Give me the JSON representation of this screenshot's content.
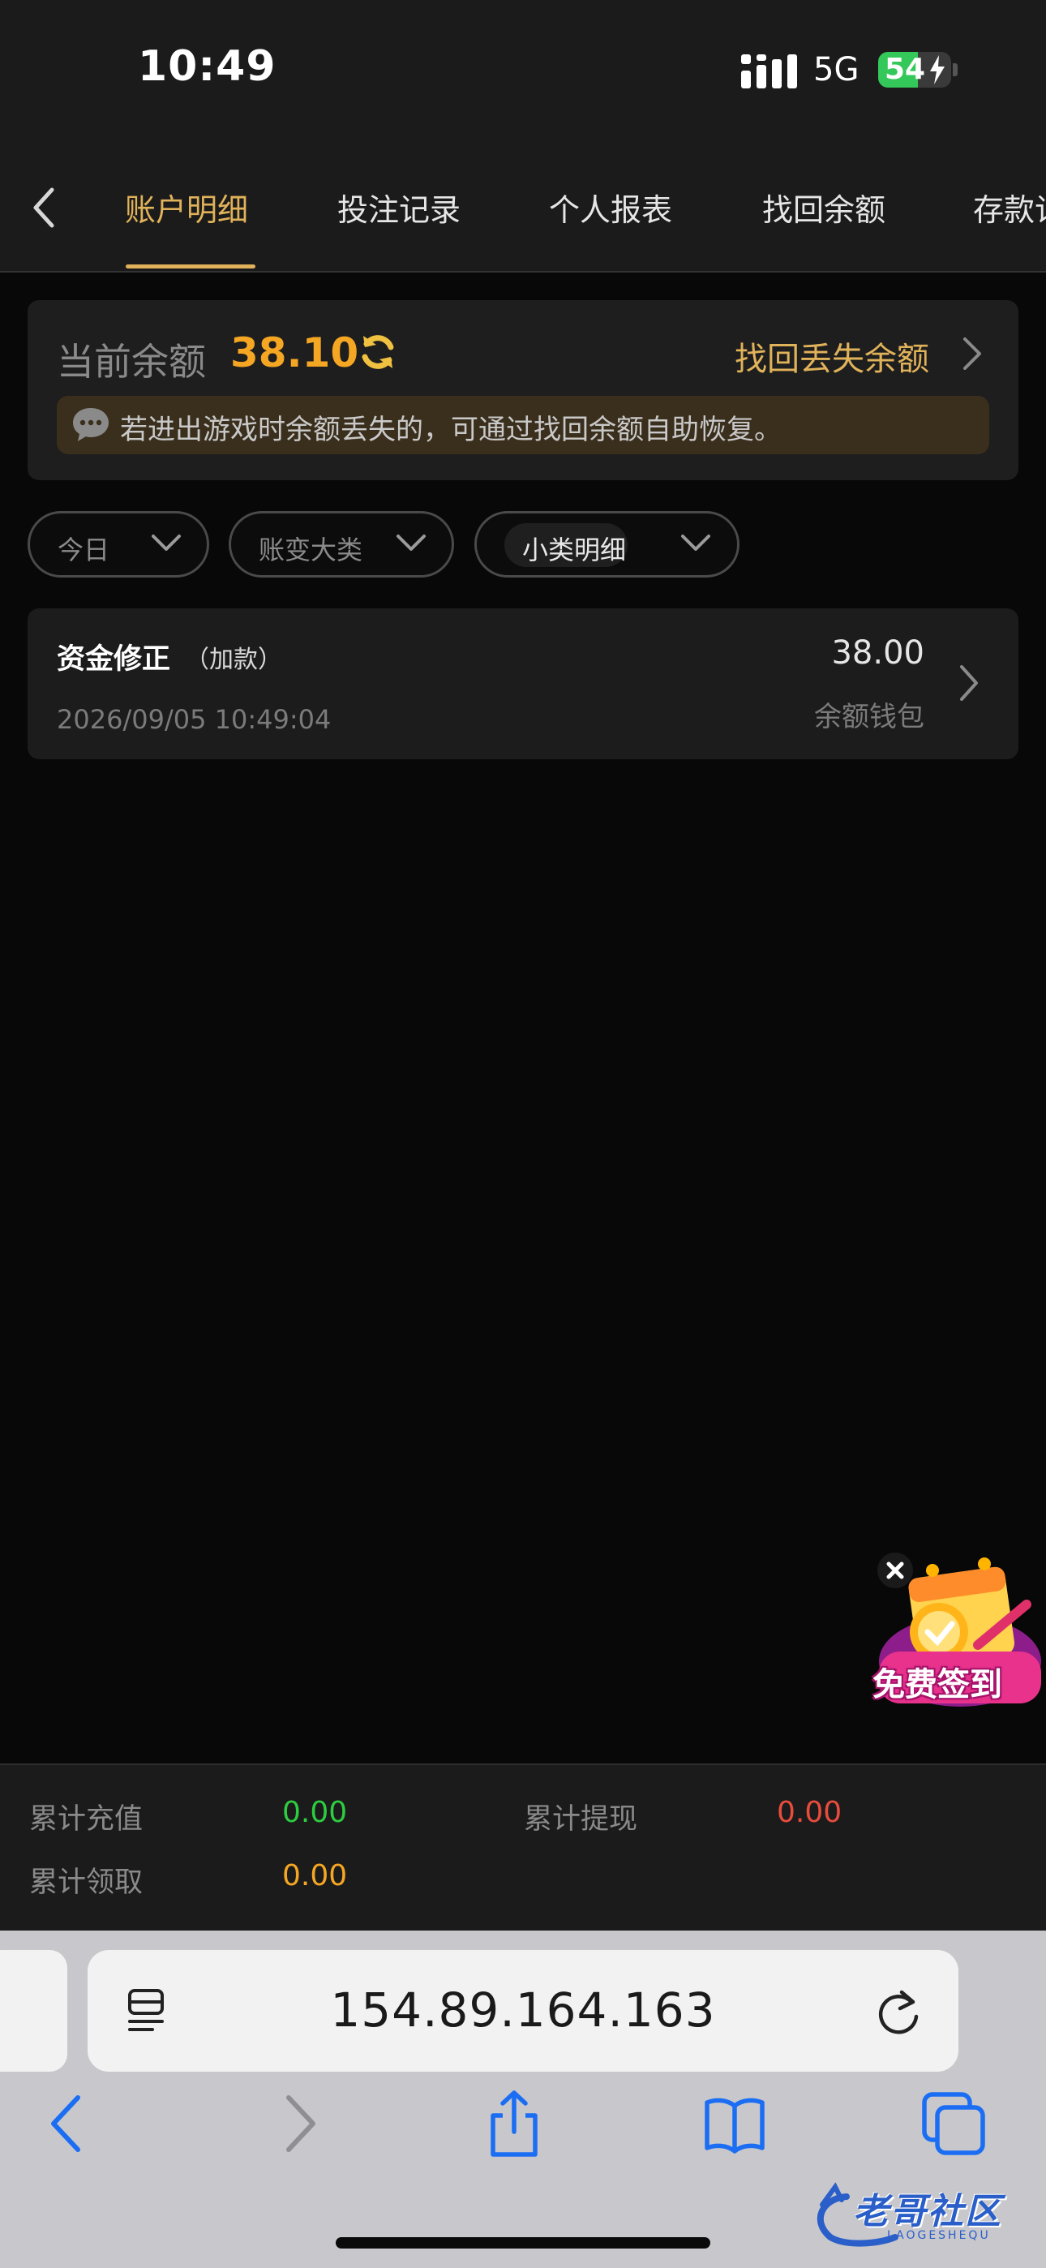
{
  "status_bar": {
    "time": "10:49",
    "network": "5G",
    "battery": "54",
    "battery_level": 0.54
  },
  "tabs": [
    {
      "label": "账户明细",
      "active": true
    },
    {
      "label": "投注记录",
      "active": false
    },
    {
      "label": "个人报表",
      "active": false
    },
    {
      "label": "找回余额",
      "active": false
    },
    {
      "label": "存款记",
      "active": false
    }
  ],
  "balance": {
    "label": "当前余额",
    "value": "38.10",
    "recover_link": "找回丢失余额",
    "notice": "若进出游戏时余额丢失的，可通过找回余额自助恢复。"
  },
  "filters": {
    "period": "今日",
    "major_category": "账变大类",
    "minor_category": "小类明细"
  },
  "records": [
    {
      "title": "资金修正",
      "subtitle": "（加款）",
      "amount": "38.00",
      "time": "2026/09/05 10:49:04",
      "wallet": "余额钱包"
    }
  ],
  "signin_badge": {
    "label": "免费签到"
  },
  "totals": {
    "recharge_label": "累计充值",
    "recharge_value": "0.00",
    "withdraw_label": "累计提现",
    "withdraw_value": "0.00",
    "claim_label": "累计领取",
    "claim_value": "0.00"
  },
  "browser": {
    "url": "154.89.164.163"
  },
  "watermark": {
    "label": "老哥社区",
    "sub": "LAOGESHEQU"
  },
  "colors": {
    "accent_gold": "#e0b25a",
    "balance_orange": "#f5a623",
    "recharge_green": "#2ecc40",
    "withdraw_red": "#e74c3c",
    "claim_orange": "#f5a623"
  }
}
